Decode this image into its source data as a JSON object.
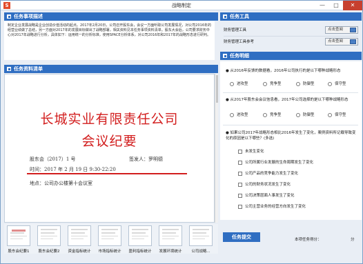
{
  "window": {
    "title": "战略制定",
    "app_icon": "S",
    "minimize": "—",
    "maximize": "□",
    "close": "✕"
  },
  "task_desc": {
    "header": "任务事项描述",
    "text": "制定企业发展战略是企业创造价值活动的起点。2017年2月20日，公司召开股东会，会议一方面听取公司发展情况，对公司2016年的经营业绩做了总结，另一方面对2017年的发展目标做出了战略部署，相关资料见本任务事项资料清单。股东大会后，公司要求财务中心对2017年战略进行分析，具体如下：运用统一的分析标准，使用SPACE分析体系，对公司2016年和2017年的战略形态进行研判。"
  },
  "task_materials": {
    "header": "任务资料清单"
  },
  "document": {
    "company": "长城实业有限责任公司",
    "doc_type": "会议纪要",
    "doc_no": "股东会（2017）1 号",
    "issuer": "签发人：罗明德",
    "time": "时间：2017 年 2 月 19 日 9:30-22:20",
    "place": "地点：公司办公楼第十会议室"
  },
  "thumbnails": [
    {
      "label": "股东会纪要1",
      "kind": "doc"
    },
    {
      "label": "股东会纪要2",
      "kind": "doc"
    },
    {
      "label": "资金指标统计",
      "kind": "table"
    },
    {
      "label": "市场指标统计",
      "kind": "table"
    },
    {
      "label": "盈利指标统计",
      "kind": "table"
    },
    {
      "label": "发展环境统计",
      "kind": "table"
    },
    {
      "label": "公司战略...",
      "kind": "table"
    }
  ],
  "task_tools": {
    "header": "任务工具",
    "items": [
      {
        "label": "财务管理工具",
        "button": "点击查阅"
      },
      {
        "label": "财务管理工具参考",
        "button": "点击查阅"
      }
    ]
  },
  "task_details": {
    "header": "任务明细",
    "questions": [
      {
        "text": "● 从2016年反馈的数据看，2016年公司执行的是以下哪种战略形态",
        "type": "radio",
        "options": [
          "进攻型",
          "竞争型",
          "防御型",
          "保守型"
        ]
      },
      {
        "text": "● 从2017年股东会会议信息看，2017年公司选择的是以下哪种战略形态",
        "type": "radio",
        "options": [
          "进攻型",
          "竞争型",
          "防御型",
          "保守型"
        ]
      },
      {
        "text": "● 如果公司2017年战略形态相比2016年发生了变化，案例资料所记载导致变化的原因是以下哪些？(多选)",
        "type": "checkbox",
        "options": [
          "未发生变化",
          "公司所属行业发展的生命周期发生了变化",
          "公司产品的竞争能力发生了变化",
          "公司的财务状况发生了变化",
          "公司决策层面人事发生了变化",
          "公司主营业务的经营方向发生了变化"
        ]
      }
    ]
  },
  "footer": {
    "submit": "任务提交",
    "score_label": "本项任务得分：",
    "score_unit": "分"
  }
}
